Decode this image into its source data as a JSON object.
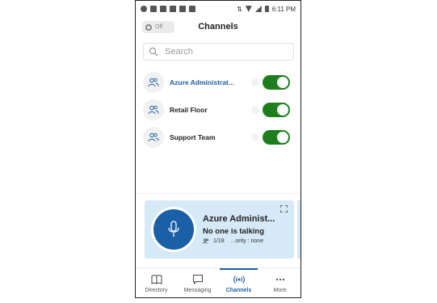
{
  "status_bar": {
    "time": "6:11 PM"
  },
  "header": {
    "title": "Channels",
    "mode_toggle_label": "Off"
  },
  "search": {
    "placeholder": "Search"
  },
  "channels": [
    {
      "name": "Azure Administrat...",
      "enabled": true,
      "active": true
    },
    {
      "name": "Retail Floor",
      "enabled": true,
      "active": false
    },
    {
      "name": "Support Team",
      "enabled": true,
      "active": false
    }
  ],
  "card": {
    "title": "Azure Administ...",
    "status": "No one is talking",
    "members": "1/18",
    "priority": "...ority : none"
  },
  "tabs": [
    {
      "label": "Directory",
      "icon": "book-icon",
      "active": false
    },
    {
      "label": "Messaging",
      "icon": "chat-icon",
      "active": false
    },
    {
      "label": "Channels",
      "icon": "radio-icon",
      "active": true
    },
    {
      "label": "More",
      "icon": "more-icon",
      "active": false
    }
  ],
  "colors": {
    "accent": "#1a60a6",
    "toggle_on": "#1e7e1e",
    "card_bg": "#d6e9f7"
  }
}
